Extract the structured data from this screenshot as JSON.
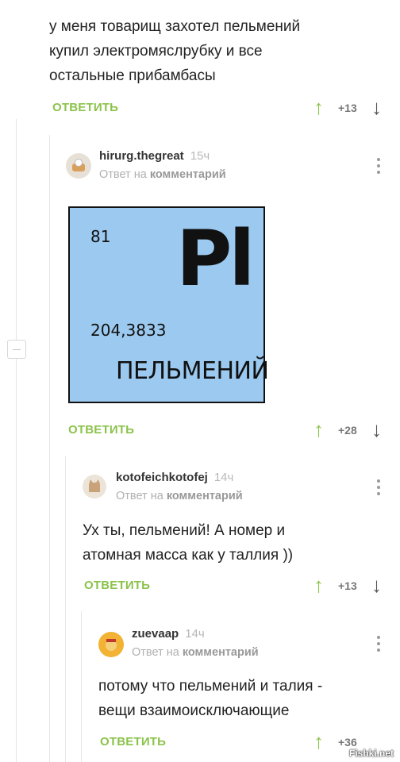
{
  "comments": [
    {
      "text_lines": [
        "у меня товарищ захотел пельмений",
        "купил электромяслрубку и все",
        "остальные прибамбасы"
      ],
      "reply_label": "ОТВЕТИТЬ",
      "score": "+13"
    },
    {
      "username": "hirurg.thegreat",
      "time": "15ч",
      "reply_to_prefix": "Ответ на",
      "reply_to_target": "комментарий",
      "element": {
        "number": "81",
        "symbol": "Pl",
        "mass": "204,3833",
        "name": "ПЕЛЬМЕНИЙ"
      },
      "reply_label": "ОТВЕТИТЬ",
      "score": "+28"
    },
    {
      "username": "kotofeichkotofej",
      "time": "14ч",
      "reply_to_prefix": "Ответ на",
      "reply_to_target": "комментарий",
      "text_lines": [
        "Ух ты, пельмений! А номер и",
        "атомная масса как у таллия ))"
      ],
      "reply_label": "ОТВЕТИТЬ",
      "score": "+13"
    },
    {
      "username": "zuevaap",
      "time": "14ч",
      "reply_to_prefix": "Ответ на",
      "reply_to_target": "комментарий",
      "text_lines": [
        "потому что пельмений и талия -",
        "вещи взаимоисключающие"
      ],
      "reply_label": "ОТВЕТИТЬ",
      "score": "+36"
    }
  ],
  "icons": {
    "up": "arrow-up-icon",
    "down": "arrow-down-icon",
    "more": "more-vertical-icon"
  },
  "colors": {
    "accent": "#8bc34a",
    "element_bg": "#9cc9ef"
  },
  "watermark": "Fishki.net"
}
